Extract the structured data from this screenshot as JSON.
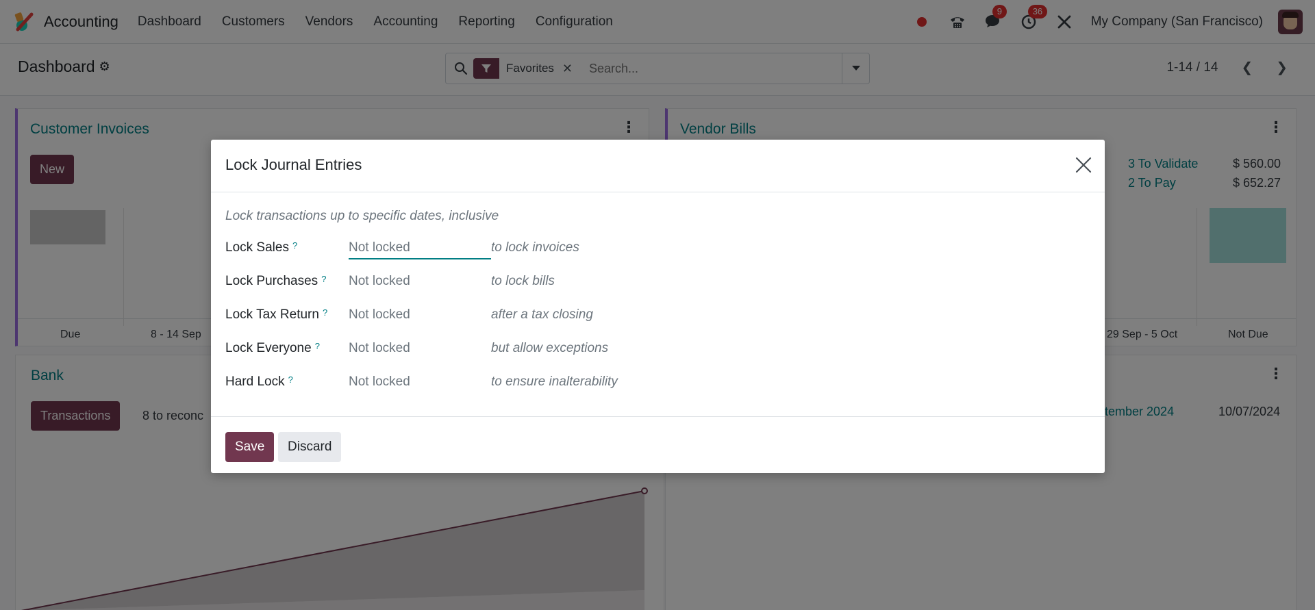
{
  "app": {
    "name": "Accounting",
    "menu": [
      "Dashboard",
      "Customers",
      "Vendors",
      "Accounting",
      "Reporting",
      "Configuration"
    ],
    "badges": {
      "messages": "9",
      "activities": "36"
    },
    "company": "My Company (San Francisco)"
  },
  "control": {
    "breadcrumb": "Dashboard",
    "search": {
      "facet": "Favorites",
      "placeholder": "Search..."
    },
    "pager": "1-14 / 14"
  },
  "dashboard": {
    "customer_invoices": {
      "title": "Customer Invoices",
      "new_label": "New",
      "axis": [
        "Due",
        "8 - 14 Sep"
      ]
    },
    "vendor_bills": {
      "title": "Vendor Bills",
      "to_validate": "3 To Validate",
      "to_validate_amount": "$ 560.00",
      "to_pay": "2 To Pay",
      "to_pay_amount": "$ 652.27",
      "axis": [
        "29 Sep - 5 Oct",
        "Not Due"
      ]
    },
    "bank": {
      "title": "Bank",
      "transactions_label": "Transactions",
      "reconcile_text": "8 to reconc"
    },
    "right_lower": {
      "period_text": "ptember 2024",
      "date": "10/07/2024"
    }
  },
  "modal": {
    "title": "Lock Journal Entries",
    "description": "Lock transactions up to specific dates, inclusive",
    "rows": [
      {
        "label": "Lock Sales",
        "value": "Not locked",
        "hint": "to lock invoices"
      },
      {
        "label": "Lock Purchases",
        "value": "Not locked",
        "hint": "to lock bills"
      },
      {
        "label": "Lock Tax Return",
        "value": "Not locked",
        "hint": "after a tax closing"
      },
      {
        "label": "Lock Everyone",
        "value": "Not locked",
        "hint": "but allow exceptions"
      },
      {
        "label": "Hard Lock",
        "value": "Not locked",
        "hint": "to ensure inalterability"
      }
    ],
    "help_mark": "?",
    "save_label": "Save",
    "discard_label": "Discard"
  }
}
